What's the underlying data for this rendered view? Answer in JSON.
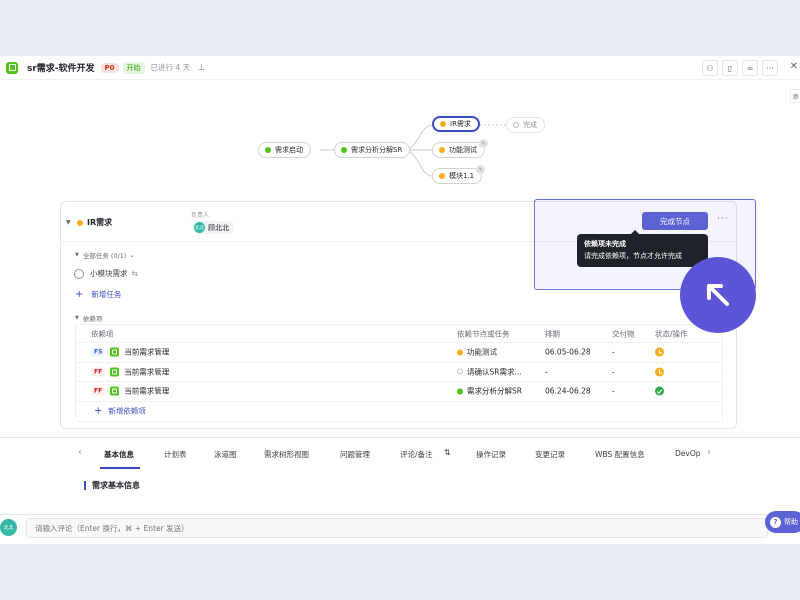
{
  "header": {
    "title": "sr需求-软件开发",
    "priority": "P0",
    "status": "开始",
    "elapsed": "已进行 4 天",
    "side_toggle": "添"
  },
  "flow": {
    "nodes": [
      {
        "label": "需求启动",
        "state": "green"
      },
      {
        "label": "需求分析分解SR",
        "state": "green"
      },
      {
        "label": "IR需求",
        "state": "yellow"
      },
      {
        "label": "完成",
        "state": "empty"
      },
      {
        "label": "功能测试",
        "state": "yellow"
      },
      {
        "label": "模块1.1",
        "state": "yellow"
      }
    ]
  },
  "card": {
    "title": "IR需求",
    "owner_label": "负责人",
    "owner_initials": "北北",
    "owner_name": "顾北北",
    "tasks_section": "全部任务 (0/1)",
    "task_name": "小模块需求",
    "add_task": "新增任务",
    "deps_section": "依赖项",
    "complete_button": "完成节点",
    "more": "···",
    "tooltip_title": "依赖项未完成",
    "tooltip_body": "请完成依赖项，节点才允许完成",
    "add_dependency": "新增依赖项"
  },
  "dep_table": {
    "headers": [
      "依赖项",
      "依赖节点或任务",
      "排期",
      "交付物",
      "状态/操作"
    ],
    "rows": [
      {
        "type": "FS",
        "item": "当前需求管理",
        "node": "功能测试",
        "node_state": "yellow",
        "schedule": "06.05-06.28",
        "deliverable": "-",
        "status": "pending"
      },
      {
        "type": "FF",
        "item": "当前需求管理",
        "node": "请确认SR需求...",
        "node_state": "empty",
        "schedule": "-",
        "deliverable": "-",
        "status": "pending"
      },
      {
        "type": "FF",
        "item": "当前需求管理",
        "node": "需求分析分解SR",
        "node_state": "green",
        "schedule": "06.24-06.28",
        "deliverable": "-",
        "status": "done"
      }
    ]
  },
  "tabs": [
    "基本信息",
    "计划表",
    "泳道图",
    "需求树形视图",
    "问题管理",
    "评论/备注",
    "操作记录",
    "变更记录",
    "WBS 配置信息",
    "DevOp"
  ],
  "basic_info": {
    "title": "需求基本信息"
  },
  "comment": {
    "avatar_initials": "北北",
    "placeholder": "请输入评论（Enter 换行，⌘ + Enter 发送）"
  },
  "help": {
    "label": "帮助"
  },
  "colors": {
    "accent": "#5b63d4",
    "green": "#52c41a",
    "yellow": "#faad14",
    "highlight": "#6b72d9"
  }
}
